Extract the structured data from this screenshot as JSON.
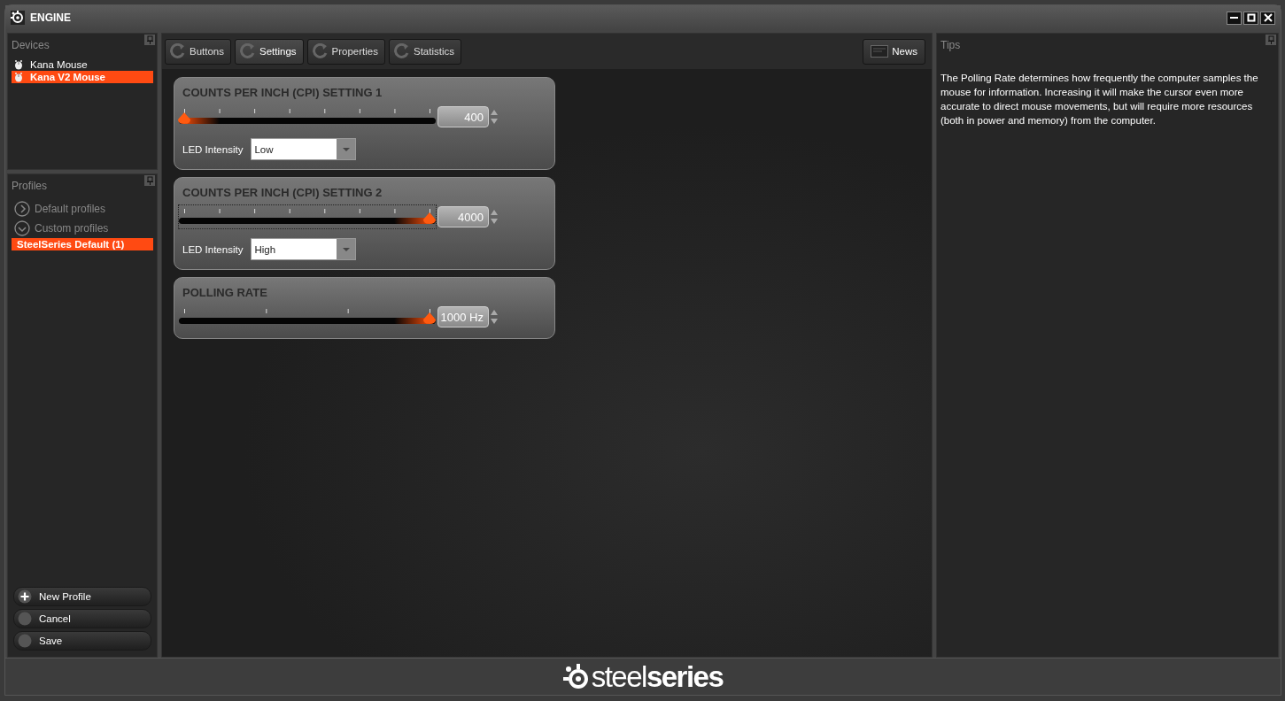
{
  "window": {
    "title": "ENGINE"
  },
  "devices": {
    "title": "Devices",
    "items": [
      {
        "label": "Kana Mouse",
        "selected": false
      },
      {
        "label": "Kana V2 Mouse",
        "selected": true
      }
    ]
  },
  "profiles": {
    "title": "Profiles",
    "groups": [
      {
        "label": "Default profiles",
        "expanded": false
      },
      {
        "label": "Custom profiles",
        "expanded": true,
        "children": [
          {
            "label": "SteelSeries Default (1)",
            "selected": true
          }
        ]
      }
    ],
    "buttons": [
      {
        "label": "New Profile",
        "kind": "add"
      },
      {
        "label": "Cancel",
        "kind": "plain"
      },
      {
        "label": "Save",
        "kind": "plain"
      }
    ]
  },
  "tabs": [
    {
      "label": "Buttons",
      "selected": false
    },
    {
      "label": "Settings",
      "selected": true
    },
    {
      "label": "Properties",
      "selected": false
    },
    {
      "label": "Statistics",
      "selected": false
    }
  ],
  "news_button": {
    "label": "News"
  },
  "settings": [
    {
      "kind": "slider_dropdown",
      "title": "COUNTS PER INCH (CPI) SETTING 1",
      "level": 0.0,
      "value": "400",
      "focused": false,
      "led_label": "LED Intensity",
      "led_value": "Low"
    },
    {
      "kind": "slider_dropdown",
      "title": "COUNTS PER INCH (CPI) SETTING 2",
      "level": 1.0,
      "value": "4000",
      "focused": true,
      "led_label": "LED Intensity",
      "led_value": "High"
    },
    {
      "kind": "slider",
      "title": "POLLING RATE",
      "level": 1.0,
      "value": "1000 Hz",
      "focused": false
    }
  ],
  "tips": {
    "title": "Tips",
    "text": "The Polling Rate determines how frequently the computer samples the mouse for information.  Increasing it will make the cursor even more accurate to direct mouse movements, but will require more resources (both in power and memory) from the computer."
  },
  "footer": {
    "logo": "steel**series**"
  }
}
